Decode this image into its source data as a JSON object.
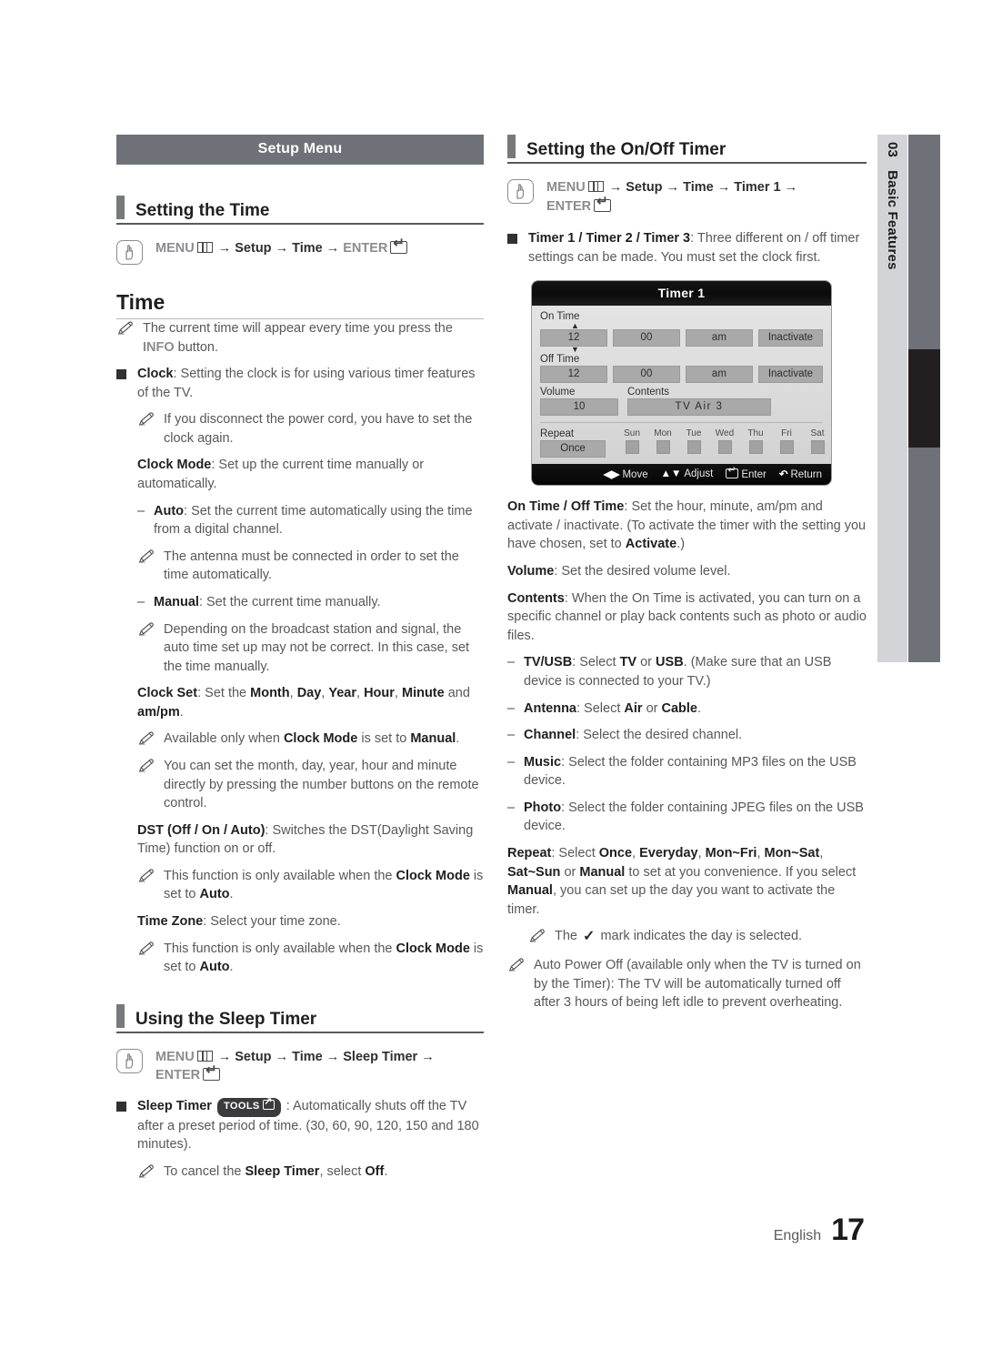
{
  "sidetab": {
    "number": "03",
    "label": "Basic Features"
  },
  "footer": {
    "language": "English",
    "page": "17"
  },
  "left": {
    "banner": "Setup Menu",
    "section1": {
      "title": "Setting the Time"
    },
    "nav1": {
      "menu": "MENU",
      "p1": "Setup",
      "p2": "Time",
      "enter": "ENTER"
    },
    "big_heading": "Time",
    "items": [
      {
        "mark": "note",
        "indent": 0,
        "text": "The current time will appear every time you press the <span class=\"gray-b\">INFO</span> button."
      },
      {
        "mark": "square",
        "indent": 0,
        "text": "<b>Clock</b>: Setting the clock is for using various timer features of the TV."
      },
      {
        "mark": "note",
        "indent": 1,
        "text": "If you disconnect the power cord, you have to set the clock again."
      },
      {
        "mark": "none",
        "indent": 1,
        "text": "<b>Clock Mode</b>: Set up the current time manually or automatically."
      },
      {
        "mark": "dash",
        "indent": 1,
        "text": "<b>Auto</b>: Set the current time automatically using the time from a digital channel."
      },
      {
        "mark": "note",
        "indent": 1,
        "text": "The antenna must be connected in order to set the time automatically."
      },
      {
        "mark": "dash",
        "indent": 1,
        "text": "<b>Manual</b>: Set the current time manually."
      },
      {
        "mark": "note",
        "indent": 1,
        "text": "Depending on the broadcast station and signal, the auto time set up may not be correct. In this case, set the time manually."
      },
      {
        "mark": "none",
        "indent": 1,
        "text": "<b>Clock Set</b>: Set the <b>Month</b>, <b>Day</b>, <b>Year</b>, <b>Hour</b>, <b>Minute</b> and <b>am/pm</b>."
      },
      {
        "mark": "note",
        "indent": 1,
        "text": "Available only when <b>Clock Mode</b> is set to <b>Manual</b>."
      },
      {
        "mark": "note",
        "indent": 1,
        "text": "You can set the month, day, year, hour and minute directly by pressing the number buttons on the remote control."
      },
      {
        "mark": "none",
        "indent": 1,
        "text": "<b>DST (Off / On / Auto)</b>: Switches the DST(Daylight Saving Time) function on or off."
      },
      {
        "mark": "note",
        "indent": 1,
        "text": "This function is only available when the <b>Clock Mode</b> is set to <b>Auto</b>."
      },
      {
        "mark": "none",
        "indent": 1,
        "text": "<b>Time Zone</b>: Select your time zone."
      },
      {
        "mark": "note",
        "indent": 1,
        "text": "This function is only available when the <b>Clock Mode</b> is set to <b>Auto</b>."
      }
    ],
    "section2": {
      "title": "Using the Sleep Timer"
    },
    "nav2": {
      "menu": "MENU",
      "p1": "Setup",
      "p2": "Time",
      "p3": "Sleep Timer",
      "enter": "ENTER"
    },
    "items2": [
      {
        "mark": "square",
        "indent": 0,
        "text": "<b>Sleep Timer</b> <span class=\"tools-slot\"></span> : Automatically shuts off the TV after a preset period of time. (30, 60, 90, 120, 150 and 180 minutes)."
      },
      {
        "mark": "note",
        "indent": 1,
        "text": "To cancel the <b>Sleep Timer</b>, select <b>Off</b>."
      }
    ],
    "tools_badge": "TOOLS"
  },
  "right": {
    "section1": {
      "title": "Setting the On/Off Timer"
    },
    "nav1": {
      "menu": "MENU",
      "p1": "Setup",
      "p2": "Time",
      "p3": "Timer 1",
      "enter": "ENTER"
    },
    "intro": {
      "mark": "square",
      "text": "<b>Timer 1 / Timer 2 / Timer 3</b>: Three different on / off timer settings can be made. You must set the clock first."
    },
    "osd": {
      "title": "Timer 1",
      "on_time_label": "On Time",
      "on_time": {
        "hour": "12",
        "minute": "00",
        "ampm": "am",
        "state": "Inactivate"
      },
      "off_time_label": "Off Time",
      "off_time": {
        "hour": "12",
        "minute": "00",
        "ampm": "am",
        "state": "Inactivate"
      },
      "volume_label": "Volume",
      "volume": "10",
      "contents_label": "Contents",
      "contents": "TV  Air  3",
      "repeat_label": "Repeat",
      "repeat": "Once",
      "days": [
        "Sun",
        "Mon",
        "Tue",
        "Wed",
        "Thu",
        "Fri",
        "Sat"
      ],
      "footer": {
        "move": "Move",
        "adjust": "Adjust",
        "enter": "Enter",
        "return": "Return"
      }
    },
    "items": [
      {
        "mark": "none",
        "indent": 0,
        "text": "<b>On Time / Off Time</b>: Set the hour, minute, am/pm and activate / inactivate. (To activate the timer with the setting you have chosen, set to <b>Activate</b>.)"
      },
      {
        "mark": "none",
        "indent": 0,
        "text": "<b>Volume</b>: Set the desired volume level."
      },
      {
        "mark": "none",
        "indent": 0,
        "text": "<b>Contents</b>: When the On Time is activated, you can turn on a specific channel or play back contents such as photo or audio files."
      },
      {
        "mark": "dash",
        "indent": 0,
        "text": "<b>TV/USB</b>: Select <b>TV</b> or <b>USB</b>. (Make sure that an USB device is connected to your TV.)"
      },
      {
        "mark": "dash",
        "indent": 0,
        "text": "<b>Antenna</b>: Select <b>Air</b> or <b>Cable</b>."
      },
      {
        "mark": "dash",
        "indent": 0,
        "text": "<b>Channel</b>: Select the desired channel."
      },
      {
        "mark": "dash",
        "indent": 0,
        "text": "<b>Music</b>: Select the folder containing MP3 files on the USB device."
      },
      {
        "mark": "dash",
        "indent": 0,
        "text": "<b>Photo</b>: Select the folder containing JPEG files on the USB device."
      },
      {
        "mark": "none",
        "indent": 0,
        "text": "<b>Repeat</b>: Select <b>Once</b>, <b>Everyday</b>, <b>Mon~Fri</b>, <b>Mon~Sat</b>, <b>Sat~Sun</b> or <b>Manual</b> to set at you convenience. If you select <b>Manual</b>, you can set up the day you want to activate the timer."
      },
      {
        "mark": "note",
        "indent": 1,
        "text": "The <span class=\"chk\">✓</span> mark indicates the day is selected."
      },
      {
        "mark": "note-out",
        "indent": 0,
        "text": "Auto Power Off (available only when the TV is turned on by the Timer): The TV will be automatically turned off after 3 hours of being left idle to prevent overheating."
      }
    ]
  }
}
